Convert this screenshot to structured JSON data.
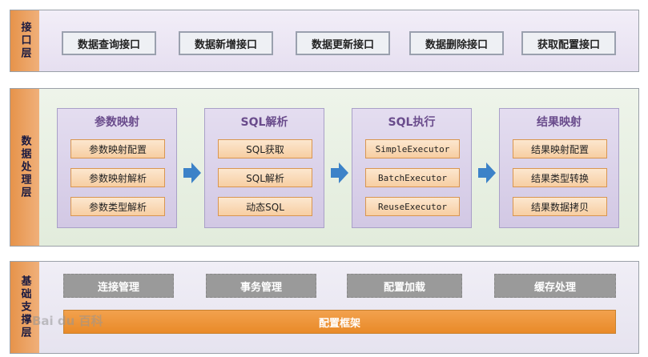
{
  "layers": {
    "interface": {
      "label": "接口层",
      "buttons": [
        "数据查询接口",
        "数据新增接口",
        "数据更新接口",
        "数据删除接口",
        "获取配置接口"
      ]
    },
    "processing": {
      "label": "数据处理层",
      "modules": [
        {
          "title": "参数映射",
          "items": [
            "参数映射配置",
            "参数映射解析",
            "参数类型解析"
          ]
        },
        {
          "title": "SQL解析",
          "items": [
            "SQL获取",
            "SQL解析",
            "动态SQL"
          ]
        },
        {
          "title": "SQL执行",
          "items": [
            "SimpleExecutor",
            "BatchExecutor",
            "ReuseExecutor"
          ]
        },
        {
          "title": "结果映射",
          "items": [
            "结果映射配置",
            "结果类型转换",
            "结果数据拷贝"
          ]
        }
      ]
    },
    "foundation": {
      "label": "基础支撑层",
      "services": [
        "连接管理",
        "事务管理",
        "配置加载",
        "缓存处理"
      ],
      "framework": "配置框架"
    }
  },
  "colors": {
    "label_band": "#e6934a",
    "subbox_fill": "#f7cea2",
    "arrow": "#3c82c8",
    "framework_bar": "#e98a28"
  },
  "watermark": "Bai du 百科"
}
